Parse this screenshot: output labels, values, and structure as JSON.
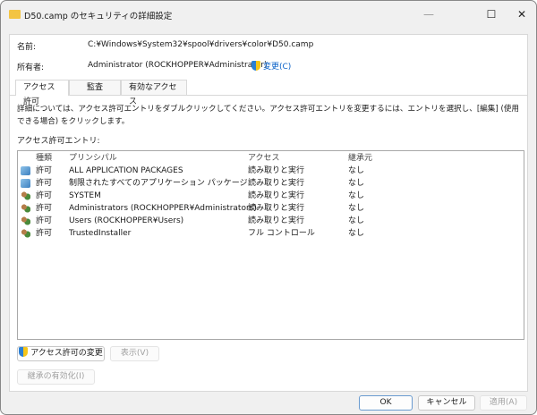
{
  "window": {
    "title": "D50.camp のセキュリティの詳細設定",
    "minimize": "—",
    "maximize": "☐",
    "close": "✕"
  },
  "info": {
    "name_label": "名前:",
    "name_value": "C:¥Windows¥System32¥spool¥drivers¥color¥D50.camp",
    "owner_label": "所有者:",
    "owner_value": "Administrator (ROCKHOPPER¥Administrator)",
    "change_link": "変更(C)"
  },
  "tabs": [
    {
      "label": "アクセス許可"
    },
    {
      "label": "監査"
    },
    {
      "label": "有効なアクセス"
    }
  ],
  "description": "詳細については、アクセス許可エントリをダブルクリックしてください。アクセス許可エントリを変更するには、エントリを選択し、[編集] (使用できる場合) をクリックします。",
  "entries_label": "アクセス許可エントリ:",
  "columns": {
    "type": "種類",
    "principal": "プリンシパル",
    "access": "アクセス",
    "inherited": "継承元"
  },
  "entries": [
    {
      "icon": "package-icon",
      "type": "許可",
      "principal": "ALL APPLICATION PACKAGES",
      "access": "読み取りと実行",
      "inherited": "なし"
    },
    {
      "icon": "package-icon",
      "type": "許可",
      "principal": "制限されたすべてのアプリケーション パッケージ",
      "access": "読み取りと実行",
      "inherited": "なし"
    },
    {
      "icon": "users-icon",
      "type": "許可",
      "principal": "SYSTEM",
      "access": "読み取りと実行",
      "inherited": "なし"
    },
    {
      "icon": "users-icon",
      "type": "許可",
      "principal": "Administrators (ROCKHOPPER¥Administrators)",
      "access": "読み取りと実行",
      "inherited": "なし"
    },
    {
      "icon": "users-icon",
      "type": "許可",
      "principal": "Users (ROCKHOPPER¥Users)",
      "access": "読み取りと実行",
      "inherited": "なし"
    },
    {
      "icon": "users-icon",
      "type": "許可",
      "principal": "TrustedInstaller",
      "access": "フル コントロール",
      "inherited": "なし"
    }
  ],
  "buttons": {
    "change_permissions": "アクセス許可の変更",
    "view": "表示(V)",
    "enable_inheritance": "継承の有効化(I)",
    "ok": "OK",
    "cancel": "キャンセル",
    "apply": "適用(A)"
  }
}
